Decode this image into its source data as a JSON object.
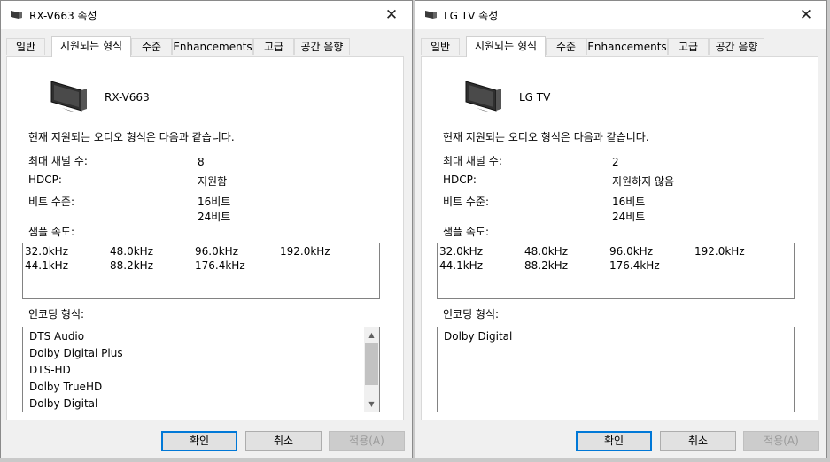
{
  "windows": [
    {
      "title": "RX-V663 속성",
      "tabs": [
        "일반",
        "지원되는 형식",
        "수준",
        "Enhancements",
        "고급",
        "공간 음향"
      ],
      "device_name": "RX-V663",
      "intro": "현재 지원되는 오디오 형식은 다음과 같습니다.",
      "labels": {
        "channels": "최대 채널 수:",
        "hdcp": "HDCP:",
        "bits": "비트 수준:",
        "rates": "샘플 속도:",
        "encoding": "인코딩 형식:"
      },
      "values": {
        "channels": "8",
        "hdcp": "지원함",
        "bits": [
          "16비트",
          "24비트"
        ]
      },
      "sample_rates": [
        [
          "32.0kHz",
          "48.0kHz",
          "96.0kHz",
          "192.0kHz"
        ],
        [
          "44.1kHz",
          "88.2kHz",
          "176.4kHz"
        ]
      ],
      "encodings": [
        "DTS Audio",
        "Dolby Digital Plus",
        "DTS-HD",
        "Dolby TrueHD",
        "Dolby Digital"
      ],
      "buttons": {
        "ok": "확인",
        "cancel": "취소",
        "apply": "적용(A)"
      }
    },
    {
      "title": "LG TV 속성",
      "tabs": [
        "일반",
        "지원되는 형식",
        "수준",
        "Enhancements",
        "고급",
        "공간 음향"
      ],
      "device_name": "LG TV",
      "intro": "현재 지원되는 오디오 형식은 다음과 같습니다.",
      "labels": {
        "channels": "최대 채널 수:",
        "hdcp": "HDCP:",
        "bits": "비트 수준:",
        "rates": "샘플 속도:",
        "encoding": "인코딩 형식:"
      },
      "values": {
        "channels": "2",
        "hdcp": "지원하지 않음",
        "bits": [
          "16비트",
          "24비트"
        ]
      },
      "sample_rates": [
        [
          "32.0kHz",
          "48.0kHz",
          "96.0kHz",
          "192.0kHz"
        ],
        [
          "44.1kHz",
          "88.2kHz",
          "176.4kHz"
        ]
      ],
      "encodings": [
        "Dolby Digital"
      ],
      "buttons": {
        "ok": "확인",
        "cancel": "취소",
        "apply": "적용(A)"
      }
    }
  ]
}
